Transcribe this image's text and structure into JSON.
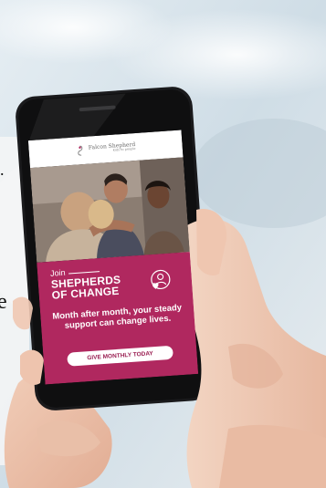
{
  "app": {
    "logo_name": "Falcon Shepherd",
    "logo_tag": "Kids to people"
  },
  "promo": {
    "join_label": "Join",
    "headline_line1": "SHEPHERDS",
    "headline_line2": "OF CHANGE",
    "tagline": "Month after month, your steady support can change lives.",
    "cta_label": "GIVE MONTHLY TODAY"
  },
  "page_edge": {
    "dot_glyph": ".",
    "letter_glyph": "e"
  },
  "colors": {
    "brand_magenta": "#b0285f",
    "cta_text": "#9a1f52",
    "phone_body": "#1a1a1c"
  },
  "icons": {
    "logo": "shepherd-logo-icon",
    "badge": "person-heart-icon"
  }
}
